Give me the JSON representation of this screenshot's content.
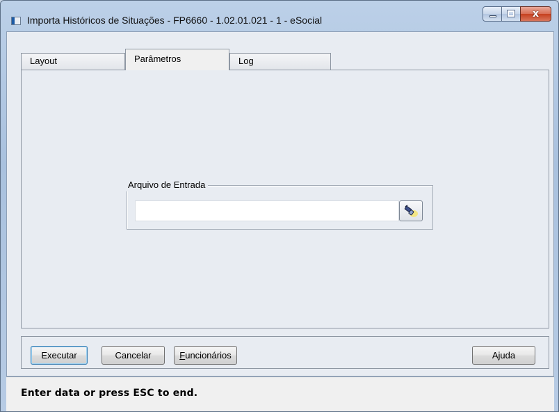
{
  "window": {
    "title": "Importa Históricos de Situações - FP6660 - 1.02.01.021 - 1 - eSocial",
    "icon": "app-window-icon",
    "caption_buttons": {
      "minimize_icon": "minimize-icon",
      "maximize_icon": "maximize-icon",
      "close_icon": "close-icon",
      "close_glyph": "x"
    }
  },
  "tabs": [
    {
      "label": "Layout",
      "active": false
    },
    {
      "label": "Parâmetros",
      "active": true
    },
    {
      "label": "Log",
      "active": false
    }
  ],
  "parameters": {
    "group_label": "Arquivo de Entrada",
    "file_input_value": "",
    "file_input_placeholder": "",
    "browse_icon": "flashlight-search-icon"
  },
  "buttons": {
    "executar": "Executar",
    "cancelar": "Cancelar",
    "funcionarios_first": "F",
    "funcionarios_rest": "uncionários",
    "ajuda": "Ajuda"
  },
  "status_bar": {
    "text": "Enter data or press ESC to end."
  },
  "colors": {
    "client_bg": "#e8ecf2",
    "close_button": "#c6401f",
    "default_button_border": "#3c7fb1"
  }
}
